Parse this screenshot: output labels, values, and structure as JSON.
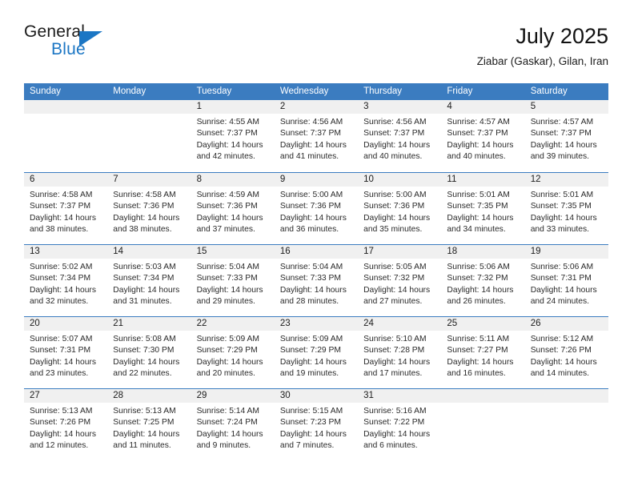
{
  "brand": {
    "name_part1": "General",
    "name_part2": "Blue",
    "triangle_color": "#1b76c4"
  },
  "header": {
    "title": "July 2025",
    "subtitle": "Ziabar (Gaskar), Gilan, Iran",
    "header_bg": "#3b7cc0",
    "datestrip_bg": "#f0f0f0"
  },
  "weekdays": [
    "Sunday",
    "Monday",
    "Tuesday",
    "Wednesday",
    "Thursday",
    "Friday",
    "Saturday"
  ],
  "weeks": [
    [
      {
        "day": "",
        "lines": []
      },
      {
        "day": "",
        "lines": []
      },
      {
        "day": "1",
        "lines": [
          "Sunrise: 4:55 AM",
          "Sunset: 7:37 PM",
          "Daylight: 14 hours",
          "and 42 minutes."
        ]
      },
      {
        "day": "2",
        "lines": [
          "Sunrise: 4:56 AM",
          "Sunset: 7:37 PM",
          "Daylight: 14 hours",
          "and 41 minutes."
        ]
      },
      {
        "day": "3",
        "lines": [
          "Sunrise: 4:56 AM",
          "Sunset: 7:37 PM",
          "Daylight: 14 hours",
          "and 40 minutes."
        ]
      },
      {
        "day": "4",
        "lines": [
          "Sunrise: 4:57 AM",
          "Sunset: 7:37 PM",
          "Daylight: 14 hours",
          "and 40 minutes."
        ]
      },
      {
        "day": "5",
        "lines": [
          "Sunrise: 4:57 AM",
          "Sunset: 7:37 PM",
          "Daylight: 14 hours",
          "and 39 minutes."
        ]
      }
    ],
    [
      {
        "day": "6",
        "lines": [
          "Sunrise: 4:58 AM",
          "Sunset: 7:37 PM",
          "Daylight: 14 hours",
          "and 38 minutes."
        ]
      },
      {
        "day": "7",
        "lines": [
          "Sunrise: 4:58 AM",
          "Sunset: 7:36 PM",
          "Daylight: 14 hours",
          "and 38 minutes."
        ]
      },
      {
        "day": "8",
        "lines": [
          "Sunrise: 4:59 AM",
          "Sunset: 7:36 PM",
          "Daylight: 14 hours",
          "and 37 minutes."
        ]
      },
      {
        "day": "9",
        "lines": [
          "Sunrise: 5:00 AM",
          "Sunset: 7:36 PM",
          "Daylight: 14 hours",
          "and 36 minutes."
        ]
      },
      {
        "day": "10",
        "lines": [
          "Sunrise: 5:00 AM",
          "Sunset: 7:36 PM",
          "Daylight: 14 hours",
          "and 35 minutes."
        ]
      },
      {
        "day": "11",
        "lines": [
          "Sunrise: 5:01 AM",
          "Sunset: 7:35 PM",
          "Daylight: 14 hours",
          "and 34 minutes."
        ]
      },
      {
        "day": "12",
        "lines": [
          "Sunrise: 5:01 AM",
          "Sunset: 7:35 PM",
          "Daylight: 14 hours",
          "and 33 minutes."
        ]
      }
    ],
    [
      {
        "day": "13",
        "lines": [
          "Sunrise: 5:02 AM",
          "Sunset: 7:34 PM",
          "Daylight: 14 hours",
          "and 32 minutes."
        ]
      },
      {
        "day": "14",
        "lines": [
          "Sunrise: 5:03 AM",
          "Sunset: 7:34 PM",
          "Daylight: 14 hours",
          "and 31 minutes."
        ]
      },
      {
        "day": "15",
        "lines": [
          "Sunrise: 5:04 AM",
          "Sunset: 7:33 PM",
          "Daylight: 14 hours",
          "and 29 minutes."
        ]
      },
      {
        "day": "16",
        "lines": [
          "Sunrise: 5:04 AM",
          "Sunset: 7:33 PM",
          "Daylight: 14 hours",
          "and 28 minutes."
        ]
      },
      {
        "day": "17",
        "lines": [
          "Sunrise: 5:05 AM",
          "Sunset: 7:32 PM",
          "Daylight: 14 hours",
          "and 27 minutes."
        ]
      },
      {
        "day": "18",
        "lines": [
          "Sunrise: 5:06 AM",
          "Sunset: 7:32 PM",
          "Daylight: 14 hours",
          "and 26 minutes."
        ]
      },
      {
        "day": "19",
        "lines": [
          "Sunrise: 5:06 AM",
          "Sunset: 7:31 PM",
          "Daylight: 14 hours",
          "and 24 minutes."
        ]
      }
    ],
    [
      {
        "day": "20",
        "lines": [
          "Sunrise: 5:07 AM",
          "Sunset: 7:31 PM",
          "Daylight: 14 hours",
          "and 23 minutes."
        ]
      },
      {
        "day": "21",
        "lines": [
          "Sunrise: 5:08 AM",
          "Sunset: 7:30 PM",
          "Daylight: 14 hours",
          "and 22 minutes."
        ]
      },
      {
        "day": "22",
        "lines": [
          "Sunrise: 5:09 AM",
          "Sunset: 7:29 PM",
          "Daylight: 14 hours",
          "and 20 minutes."
        ]
      },
      {
        "day": "23",
        "lines": [
          "Sunrise: 5:09 AM",
          "Sunset: 7:29 PM",
          "Daylight: 14 hours",
          "and 19 minutes."
        ]
      },
      {
        "day": "24",
        "lines": [
          "Sunrise: 5:10 AM",
          "Sunset: 7:28 PM",
          "Daylight: 14 hours",
          "and 17 minutes."
        ]
      },
      {
        "day": "25",
        "lines": [
          "Sunrise: 5:11 AM",
          "Sunset: 7:27 PM",
          "Daylight: 14 hours",
          "and 16 minutes."
        ]
      },
      {
        "day": "26",
        "lines": [
          "Sunrise: 5:12 AM",
          "Sunset: 7:26 PM",
          "Daylight: 14 hours",
          "and 14 minutes."
        ]
      }
    ],
    [
      {
        "day": "27",
        "lines": [
          "Sunrise: 5:13 AM",
          "Sunset: 7:26 PM",
          "Daylight: 14 hours",
          "and 12 minutes."
        ]
      },
      {
        "day": "28",
        "lines": [
          "Sunrise: 5:13 AM",
          "Sunset: 7:25 PM",
          "Daylight: 14 hours",
          "and 11 minutes."
        ]
      },
      {
        "day": "29",
        "lines": [
          "Sunrise: 5:14 AM",
          "Sunset: 7:24 PM",
          "Daylight: 14 hours",
          "and 9 minutes."
        ]
      },
      {
        "day": "30",
        "lines": [
          "Sunrise: 5:15 AM",
          "Sunset: 7:23 PM",
          "Daylight: 14 hours",
          "and 7 minutes."
        ]
      },
      {
        "day": "31",
        "lines": [
          "Sunrise: 5:16 AM",
          "Sunset: 7:22 PM",
          "Daylight: 14 hours",
          "and 6 minutes."
        ]
      },
      {
        "day": "",
        "lines": []
      },
      {
        "day": "",
        "lines": []
      }
    ]
  ]
}
